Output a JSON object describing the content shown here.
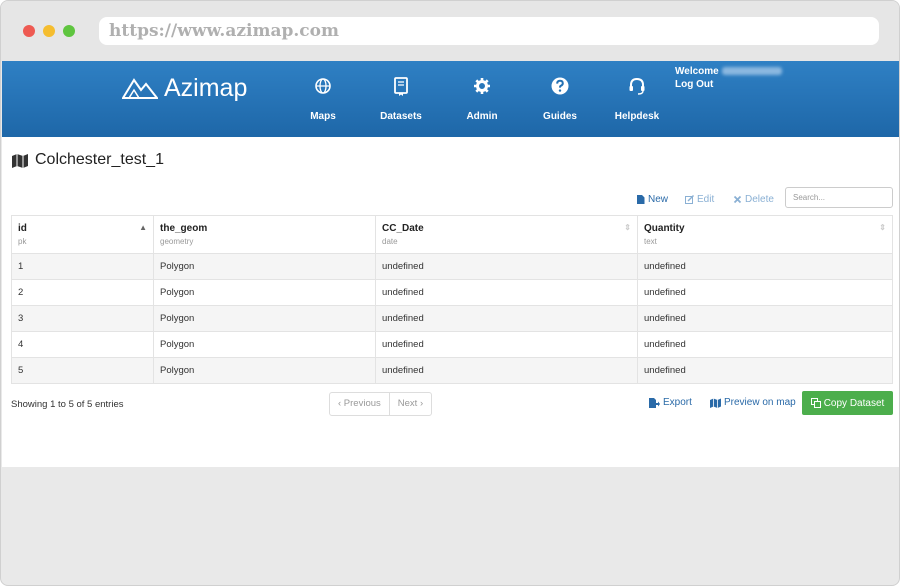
{
  "browser": {
    "url": "https://www.azimap.com"
  },
  "header": {
    "logo_text": "Azimap",
    "nav": [
      {
        "label": "Maps",
        "icon": "globe-icon"
      },
      {
        "label": "Datasets",
        "icon": "book-icon"
      },
      {
        "label": "Admin",
        "icon": "gear-icon"
      },
      {
        "label": "Guides",
        "icon": "question-icon"
      },
      {
        "label": "Helpdesk",
        "icon": "headset-icon"
      }
    ],
    "welcome_label": "Welcome",
    "logout_label": "Log Out"
  },
  "page": {
    "title": "Colchester_test_1",
    "title_icon": "map-icon"
  },
  "toolbar": {
    "new_label": "New",
    "edit_label": "Edit",
    "delete_label": "Delete",
    "search_placeholder": "Search..."
  },
  "table": {
    "columns": [
      {
        "name": "id",
        "type": "pk"
      },
      {
        "name": "the_geom",
        "type": "geometry"
      },
      {
        "name": "CC_Date",
        "type": "date"
      },
      {
        "name": "Quantity",
        "type": "text"
      }
    ],
    "rows": [
      [
        "1",
        "Polygon",
        "undefined",
        "undefined"
      ],
      [
        "2",
        "Polygon",
        "undefined",
        "undefined"
      ],
      [
        "3",
        "Polygon",
        "undefined",
        "undefined"
      ],
      [
        "4",
        "Polygon",
        "undefined",
        "undefined"
      ],
      [
        "5",
        "Polygon",
        "undefined",
        "undefined"
      ]
    ]
  },
  "footer": {
    "info": "Showing 1 to 5 of 5 entries",
    "prev_label": "‹  Previous",
    "next_label": "Next  ›",
    "export_label": "Export",
    "preview_label": "Preview on map",
    "copy_label": "Copy Dataset"
  },
  "colors": {
    "nav_bg": "#2878bc",
    "accent": "#2a6aa8",
    "copy_button": "#4cae4c"
  }
}
